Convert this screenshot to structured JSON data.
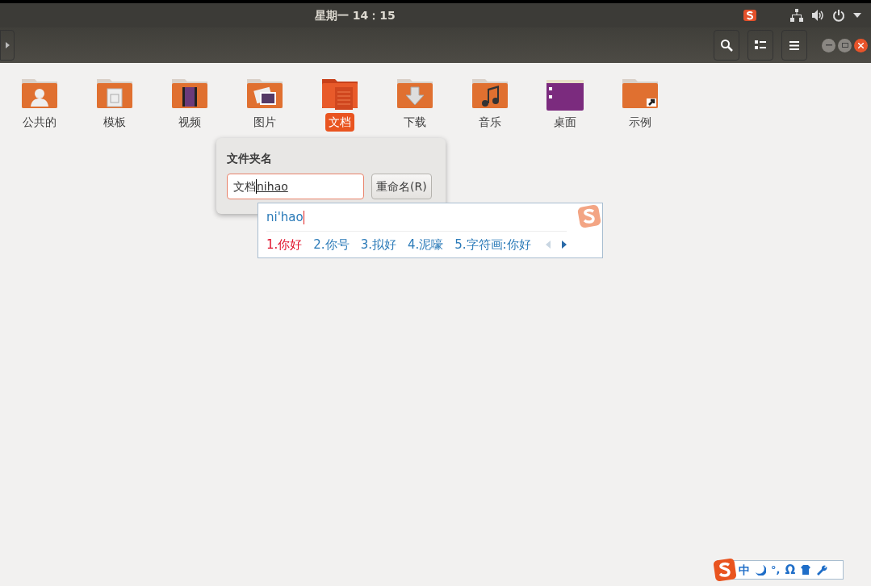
{
  "top_bar": {
    "clock": "星期一 14：15"
  },
  "folders": [
    {
      "label": "公共的",
      "kind": "person",
      "selected": false
    },
    {
      "label": "模板",
      "kind": "template",
      "selected": false
    },
    {
      "label": "视频",
      "kind": "video",
      "selected": false
    },
    {
      "label": "图片",
      "kind": "picture",
      "selected": false
    },
    {
      "label": "文档",
      "kind": "document",
      "selected": true
    },
    {
      "label": "下载",
      "kind": "download",
      "selected": false
    },
    {
      "label": "音乐",
      "kind": "music",
      "selected": false
    },
    {
      "label": "桌面",
      "kind": "desktop",
      "selected": false
    },
    {
      "label": "示例",
      "kind": "link",
      "selected": false
    }
  ],
  "rename_popover": {
    "title": "文件夹名",
    "value": "文档",
    "preedit": "nihao",
    "button": "重命名(R)"
  },
  "ime": {
    "pinyin": "ni'hao",
    "candidates": [
      {
        "text": "1.你好",
        "selected": true
      },
      {
        "text": "2.你号",
        "selected": false
      },
      {
        "text": "3.拟好",
        "selected": false
      },
      {
        "text": "4.泥嚎",
        "selected": false
      },
      {
        "text": "5.字符画:你好",
        "selected": false
      }
    ]
  },
  "ime_toolbar": {
    "mode": "中",
    "punctuation": "°,",
    "symbols": "Ω"
  }
}
